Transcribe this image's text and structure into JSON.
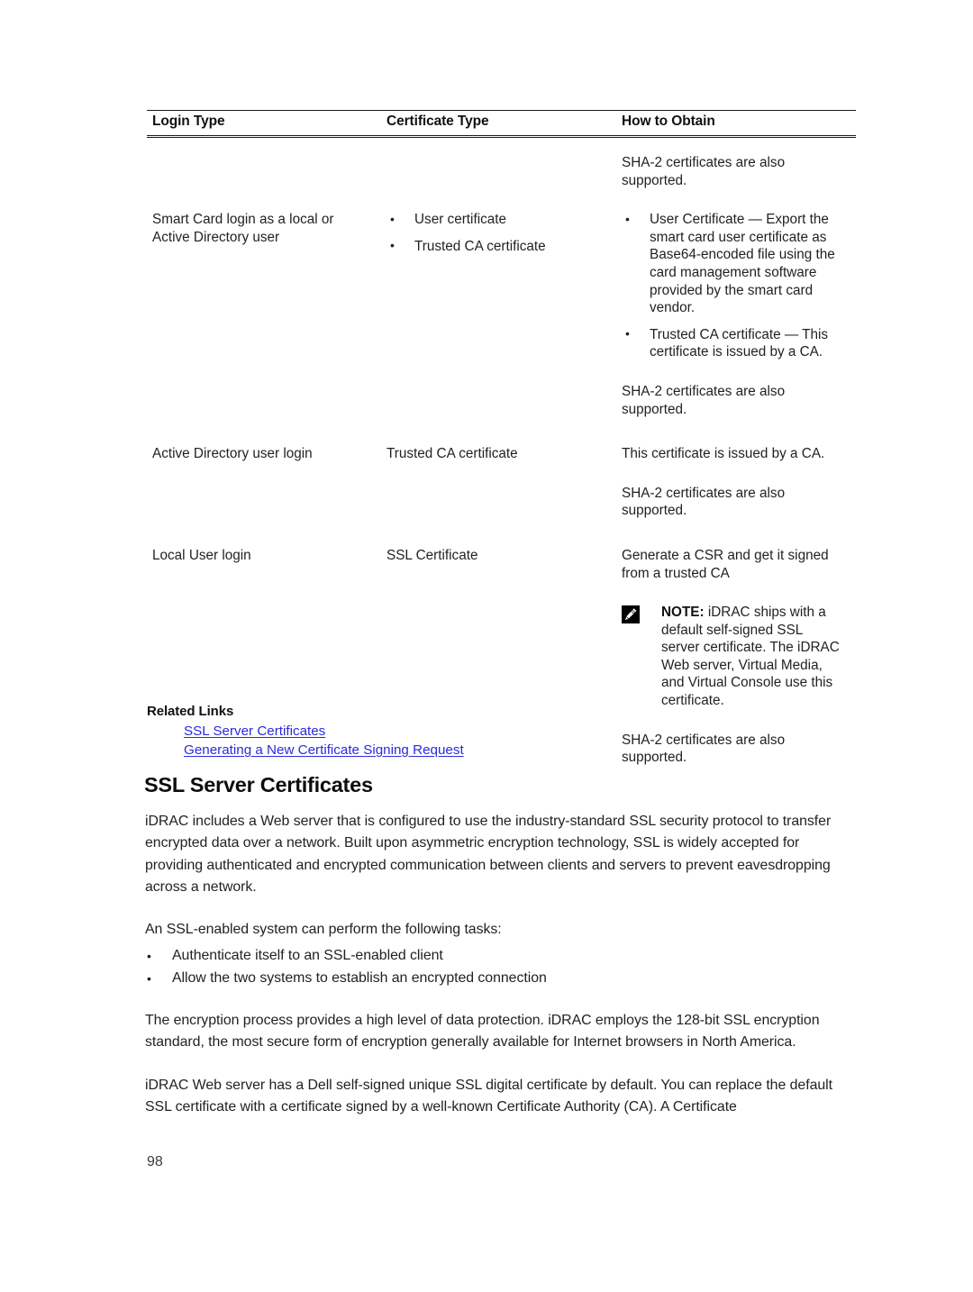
{
  "table": {
    "headers": [
      "Login Type",
      "Certificate Type",
      "How to Obtain"
    ],
    "pre_row_note": "SHA-2 certificates are also supported.",
    "rows": [
      {
        "login_type": "Smart Card login as a local or Active Directory user",
        "certificate_type_bullets": [
          "User certificate",
          "Trusted CA certificate"
        ],
        "how_to_obtain_bullets": [
          "User Certificate — Export the smart card user certificate as Base64-encoded file using the card management software provided by the smart card vendor.",
          "Trusted CA certificate — This certificate is issued by a CA."
        ],
        "how_to_obtain_trailer": "SHA-2 certificates are also supported."
      },
      {
        "login_type": "Active Directory user login",
        "certificate_type": "Trusted CA certificate",
        "how_to_obtain": "This certificate is issued by a CA.",
        "how_to_obtain_trailer": "SHA-2 certificates are also supported."
      },
      {
        "login_type": "Local User login",
        "certificate_type": "SSL Certificate",
        "how_to_obtain": "Generate a CSR and get it signed from a trusted CA",
        "note_label": "NOTE:",
        "note_text": " iDRAC ships with a default self-signed SSL server certificate. The iDRAC Web server, Virtual Media, and Virtual Console use this certificate.",
        "how_to_obtain_trailer": "SHA-2 certificates are also supported."
      }
    ],
    "bullet_glyph": "•"
  },
  "related_links": {
    "title": "Related Links",
    "links": [
      "SSL Server Certificates",
      "Generating a New Certificate Signing Request"
    ],
    "link_color": "#2a2ae0"
  },
  "section": {
    "title": "SSL Server Certificates",
    "paragraph_1": "iDRAC includes a Web server that is configured to use the industry-standard SSL security protocol to transfer encrypted data over a network. Built upon asymmetric encryption technology, SSL is widely accepted for providing authenticated and encrypted communication between clients and servers to prevent eavesdropping across a network.",
    "paragraph_2": "An SSL-enabled system can perform the following tasks:",
    "task_bullets": [
      "Authenticate itself to an SSL-enabled client",
      "Allow the two systems to establish an encrypted connection"
    ],
    "paragraph_3": "The encryption process provides a high level of data protection. iDRAC employs the 128-bit SSL encryption standard, the most secure form of encryption generally available for Internet browsers in North America.",
    "paragraph_4": "iDRAC Web server has a Dell self-signed unique SSL digital certificate by default. You can replace the default SSL certificate with a certificate signed by a well-known Certificate Authority (CA). A Certificate"
  },
  "footer": {
    "page_number": "98"
  }
}
